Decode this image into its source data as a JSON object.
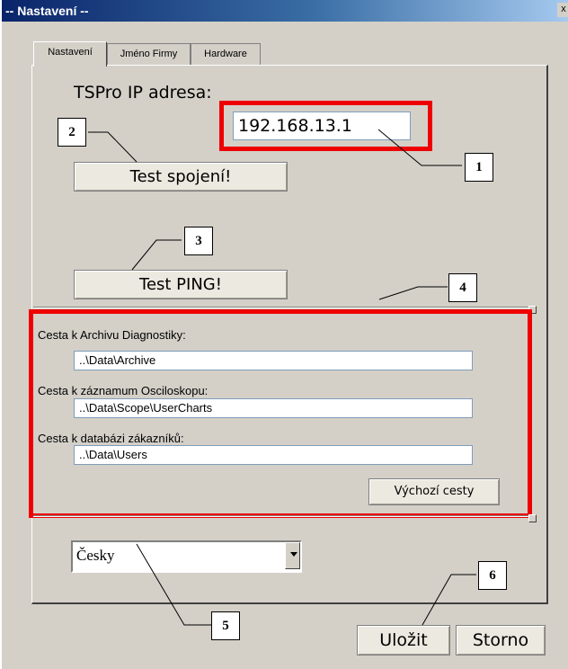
{
  "window": {
    "title": "-- Nastavení --",
    "close_glyph": "x"
  },
  "tabs": [
    {
      "label": "Nastavení"
    },
    {
      "label": "Jméno Firmy"
    },
    {
      "label": "Hardware"
    }
  ],
  "ip": {
    "label": "TSPro IP adresa:",
    "value": "192.168.13.1"
  },
  "buttons": {
    "test_connection": "Test spojení!",
    "test_ping": "Test PING!",
    "default_paths": "Výchozí cesty",
    "save": "Uložit",
    "cancel": "Storno"
  },
  "paths": [
    {
      "label": "Cesta k Archivu Diagnostiky:",
      "value": "..\\Data\\Archive"
    },
    {
      "label": "Cesta k záznamum Osciloskopu:",
      "value": "..\\Data\\Scope\\UserCharts"
    },
    {
      "label": "Cesta k databázi zákazníků:",
      "value": "..\\Data\\Users"
    }
  ],
  "language": {
    "selected": "Česky"
  },
  "callouts": [
    "1",
    "2",
    "3",
    "4",
    "5",
    "6"
  ],
  "colors": {
    "highlight": "#ee0000",
    "titlebar": "#0a246a",
    "dialog": "#d4d0c8"
  }
}
